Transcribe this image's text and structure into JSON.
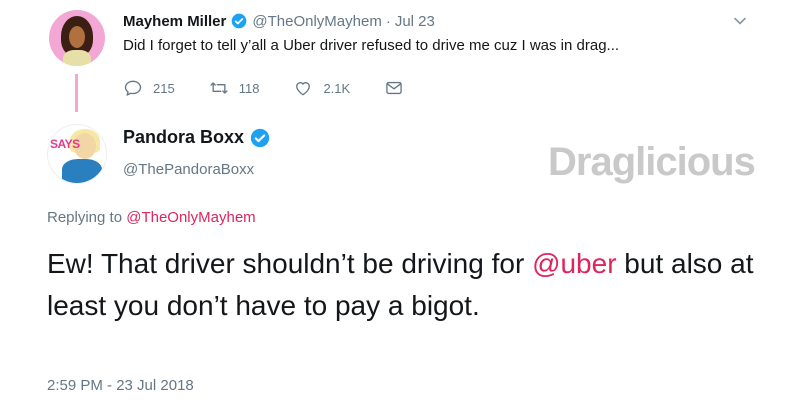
{
  "parent_tweet": {
    "name": "Mayhem Miller",
    "handle": "@TheOnlyMayhem",
    "separator": "·",
    "date": "Jul 23",
    "text": "Did I forget to tell y’all a Uber driver refused to drive me cuz I was in drag...",
    "actions": {
      "reply_count": "215",
      "retweet_count": "118",
      "like_count": "2.1K"
    }
  },
  "reply_tweet": {
    "name": "Pandora Boxx",
    "handle": "@ThePandoraBoxx",
    "avatar_text": "SAYS",
    "replying_prefix": "Replying to ",
    "replying_to": "@TheOnlyMayhem",
    "text_part1": "Ew! That driver shouldn’t be driving for ",
    "text_mention": "@uber",
    "text_part2": " but also at least you don’t have to pay a bigot.",
    "timestamp": "2:59 PM - 23 Jul 2018"
  },
  "watermark": "Draglicious",
  "colors": {
    "accent_pink": "#e0245e",
    "verified_blue": "#1da1f2",
    "secondary_text": "#657786",
    "thread_line": "#f3a9cf"
  },
  "icons": [
    "verified-icon",
    "chevron-down-icon",
    "reply-icon",
    "retweet-icon",
    "like-icon",
    "message-icon"
  ]
}
